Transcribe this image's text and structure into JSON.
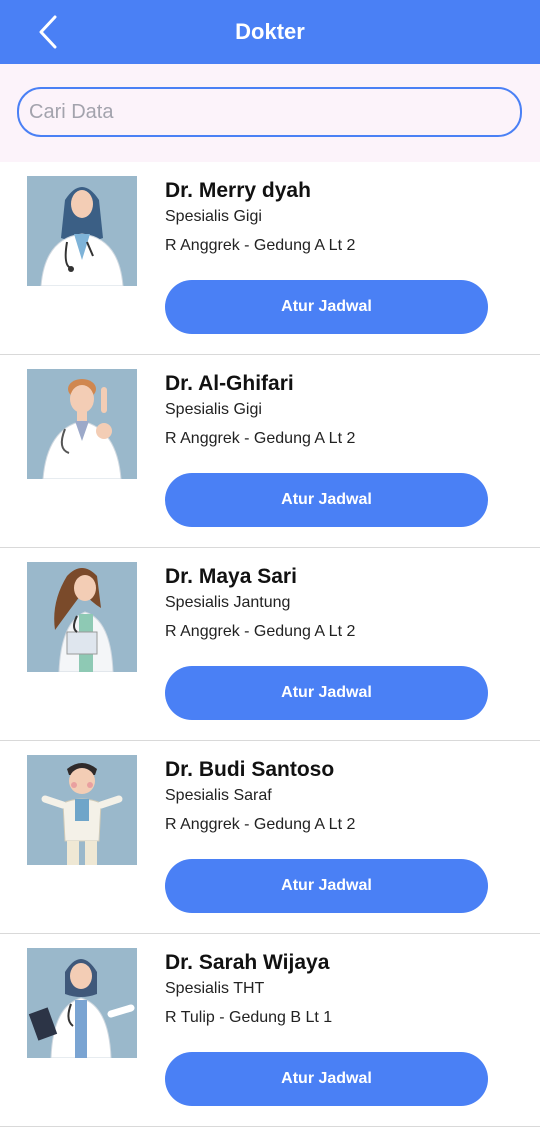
{
  "header": {
    "title": "Dokter",
    "back_icon": "chevron-left-icon"
  },
  "search": {
    "placeholder": "Cari Data",
    "value": ""
  },
  "colors": {
    "primary": "#4a80f5",
    "search_bg": "#fcf3fa",
    "avatar_bg": "#9ab8cb"
  },
  "doctors": [
    {
      "name": "Dr. Merry dyah",
      "specialty": "Spesialis Gigi",
      "room": "R Anggrek - Gedung A Lt 2",
      "button": "Atur Jadwal"
    },
    {
      "name": "Dr. Al-Ghifari",
      "specialty": "Spesialis Gigi",
      "room": "R Anggrek - Gedung A Lt 2",
      "button": "Atur Jadwal"
    },
    {
      "name": "Dr. Maya Sari",
      "specialty": "Spesialis Jantung",
      "room": "R Anggrek - Gedung A Lt 2",
      "button": "Atur Jadwal"
    },
    {
      "name": "Dr. Budi Santoso",
      "specialty": "Spesialis Saraf",
      "room": "R Anggrek - Gedung A Lt 2",
      "button": "Atur Jadwal"
    },
    {
      "name": "Dr. Sarah Wijaya",
      "specialty": "Spesialis THT",
      "room": "R Tulip - Gedung B Lt 1",
      "button": "Atur Jadwal"
    }
  ]
}
